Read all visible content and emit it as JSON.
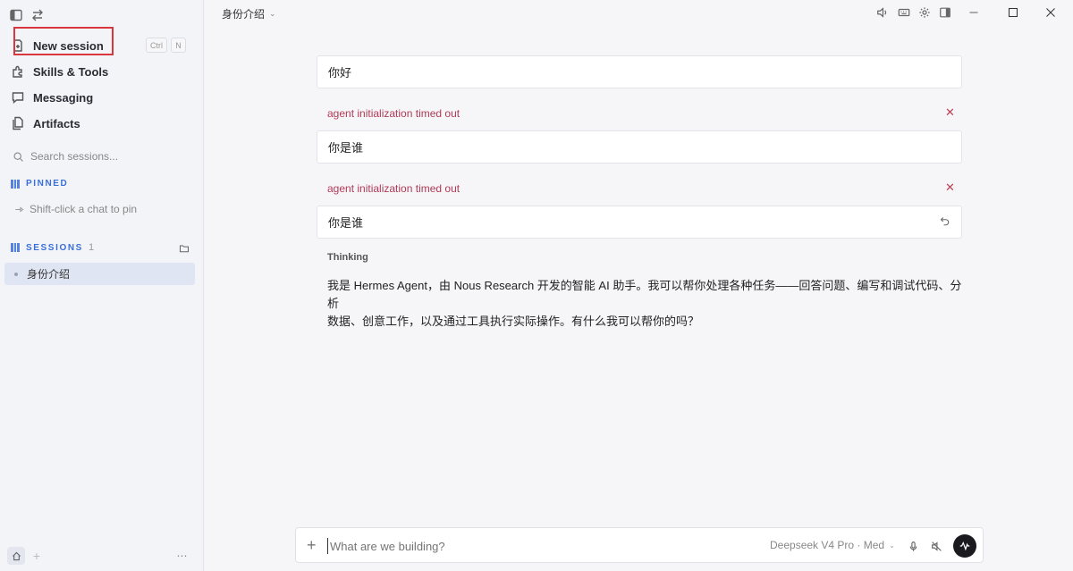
{
  "sidebar": {
    "nav": {
      "new_session": "New session",
      "skills_tools": "Skills & Tools",
      "messaging": "Messaging",
      "artifacts": "Artifacts"
    },
    "shortcut": {
      "mod": "Ctrl",
      "key": "N"
    },
    "search_placeholder": "Search sessions...",
    "pinned": {
      "header": "PINNED",
      "hint": "Shift-click a chat to pin"
    },
    "sessions": {
      "header": "SESSIONS",
      "count": "1",
      "items": [
        {
          "label": "身份介绍"
        }
      ]
    }
  },
  "header": {
    "title": "身份介绍"
  },
  "conversation": {
    "messages": [
      {
        "role": "user",
        "text": "你好"
      },
      {
        "role": "error",
        "text": "agent initialization timed out"
      },
      {
        "role": "user",
        "text": "你是谁"
      },
      {
        "role": "error",
        "text": "agent initialization timed out"
      },
      {
        "role": "user",
        "text": "你是谁"
      }
    ],
    "thinking_label": "Thinking",
    "reply_line1": "我是 Hermes Agent，由 Nous Research 开发的智能 AI 助手。我可以帮你处理各种任务——回答问题、编写和调试代码、分析",
    "reply_line2": "数据、创意工作，以及通过工具执行实际操作。有什么我可以帮你的吗？"
  },
  "composer": {
    "placeholder": "What are we building?",
    "model": "Deepseek V4 Pro · Med"
  },
  "colors": {
    "accent": "#3a6fd8",
    "error": "#b13a55",
    "highlight": "#d9363e"
  }
}
